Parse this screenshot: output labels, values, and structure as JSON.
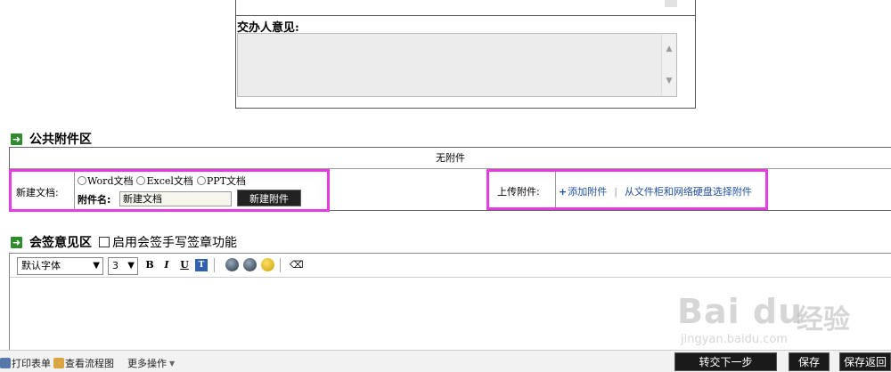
{
  "opinion": {
    "label": "交办人意见:"
  },
  "public_attachments": {
    "title": "公共附件区",
    "empty_text": "无附件",
    "new_doc": {
      "label": "新建文档:",
      "options": [
        "Word文档",
        "Excel文档",
        "PPT文档"
      ],
      "name_label": "附件名:",
      "name_value": "新建文档",
      "create_button": "新建附件"
    },
    "upload": {
      "label": "上传附件:",
      "add_link": "添加附件",
      "cabinet_link": "从文件柜和网络硬盘选择附件"
    }
  },
  "countersign": {
    "title": "会签意见区",
    "checkbox_label": "启用会签手写签章功能"
  },
  "editor": {
    "font_value": "默认字体",
    "size_value": "3",
    "bold": "B",
    "italic": "I",
    "underline": "U"
  },
  "bottom_bar": {
    "print_form": "打印表单",
    "view_flow": "查看流程图",
    "more_ops": "更多操作",
    "transfer_next": "转交下一步",
    "save": "保存",
    "save_return": "保存返回"
  },
  "watermark": {
    "logo": "Bai du",
    "cn": "经验",
    "url": "jingyan.baidu.com"
  },
  "colors": {
    "highlight": "#e63be0",
    "link": "#1f4f9c",
    "section_arrow": "#2e8b2e"
  },
  "icons": [
    "up-arrow-icon",
    "down-arrow-icon",
    "section-arrow-icon",
    "plus-icon",
    "print-icon",
    "flow-chart-icon",
    "eraser-icon",
    "smiley-icon"
  ]
}
